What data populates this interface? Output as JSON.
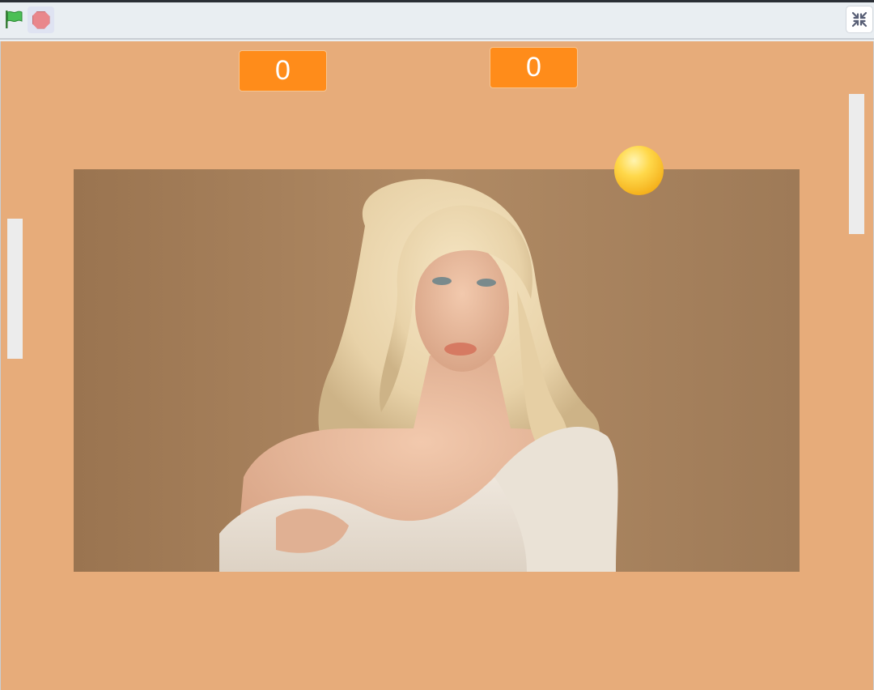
{
  "toolbar": {
    "green_flag": {
      "icon": "green-flag-icon",
      "color": "#3fa33f"
    },
    "stop": {
      "icon": "stop-icon",
      "color": "#e9878c"
    },
    "fullscreen": {
      "icon": "exit-fullscreen-icon"
    }
  },
  "stage": {
    "background_color": "#e7ac7a",
    "score_left": "0",
    "score_right": "0",
    "score_color": "#ff8c1a",
    "photo": {
      "description_icon": "portrait-photo"
    },
    "ball": {
      "color": "#ffd84a"
    },
    "paddle_color": "#ececec"
  }
}
